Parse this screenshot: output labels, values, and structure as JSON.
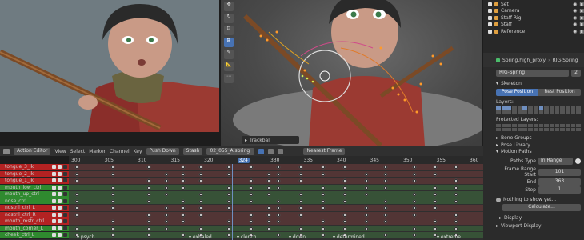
{
  "outliner": {
    "items": [
      {
        "label": "Set"
      },
      {
        "label": "Camera"
      },
      {
        "label": "Staff Rig"
      },
      {
        "label": "Staff"
      },
      {
        "label": "Reference"
      }
    ]
  },
  "viewport": {
    "trackball_label": "Trackball"
  },
  "props": {
    "object_name": "Spring.high_proxy",
    "rig_name": "RIG-Spring",
    "armature_field": "RIG-Spring",
    "users_count": "2",
    "skeleton_header": "Skeleton",
    "pose_position": "Pose Position",
    "rest_position": "Rest Position",
    "layers_label": "Layers:",
    "protected_layers_label": "Protected Layers:",
    "bone_groups": "Bone Groups",
    "pose_library": "Pose Library",
    "motion_paths": "Motion Paths",
    "paths_type_label": "Paths Type",
    "paths_type_value": "In Range",
    "frame_range_start_label": "Frame Range Start",
    "frame_range_start_value": "101",
    "end_label": "End",
    "end_value": "363",
    "step_label": "Step",
    "step_value": "1",
    "nothing_to_show": "Nothing to show yet...",
    "calculate": "Calculate...",
    "display": "Display",
    "viewport_display": "Viewport Display"
  },
  "dopesheet": {
    "mode": "Action Editor",
    "menus": [
      "View",
      "Select",
      "Marker",
      "Channel",
      "Key"
    ],
    "push_down": "Push Down",
    "stash": "Stash",
    "action_name": "02_055_A.spring",
    "interpolation": "Nearest Frame",
    "current_frame": "324",
    "ruler": [
      "300",
      "305",
      "310",
      "315",
      "320",
      "324",
      "330",
      "335",
      "340",
      "345",
      "350",
      "355",
      "360"
    ],
    "channels": [
      {
        "label": "tongue_3_ik",
        "color": "#b32222"
      },
      {
        "label": "tongue_2_ik",
        "color": "#b32222"
      },
      {
        "label": "tongue_1_ik",
        "color": "#b32222"
      },
      {
        "label": "mouth_low_ctrl",
        "color": "#2f8a2f"
      },
      {
        "label": "mouth_up_ctrl",
        "color": "#2f8a2f"
      },
      {
        "label": "nose_ctrl",
        "color": "#2f8a2f"
      },
      {
        "label": "nostril_ctrl_L",
        "color": "#b32222"
      },
      {
        "label": "nostril_ctrl_R",
        "color": "#b32222"
      },
      {
        "label": "mouth_mstr_ctrl",
        "color": "#b32222"
      },
      {
        "label": "mouth_corner_L",
        "color": "#2f8a2f"
      },
      {
        "label": "cheek_ctrl_L",
        "color": "#2f8a2f"
      }
    ],
    "markers": [
      "psych",
      "exhaled",
      "clench",
      "down",
      "determined",
      "extreme"
    ]
  },
  "colors": {
    "accent": "#4772b3",
    "red_channel": "#b32222",
    "green_channel": "#2f8a2f"
  }
}
